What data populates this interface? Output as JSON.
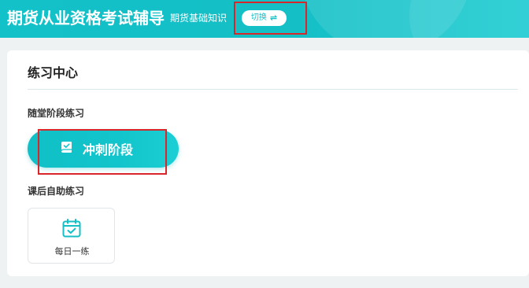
{
  "header": {
    "app_title": "期货从业资格考试辅导",
    "subject": "期货基础知识",
    "switch_label": "切换",
    "switch_icon": "⇌"
  },
  "main": {
    "section_title": "练习中心",
    "groups": [
      {
        "label": "随堂阶段练习",
        "items": [
          {
            "label": "冲刺阶段",
            "icon": "book-check-icon"
          }
        ]
      },
      {
        "label": "课后自助练习",
        "items": [
          {
            "label": "每日一练",
            "icon": "calendar-check-icon"
          }
        ]
      }
    ]
  },
  "colors": {
    "accent": "#14bfc6",
    "highlight": "#d9262a"
  }
}
